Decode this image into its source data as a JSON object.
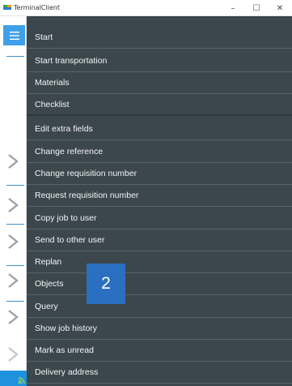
{
  "window": {
    "title": "TerminalClient",
    "minimize_glyph": "–",
    "maximize_glyph": "☐",
    "close_glyph": "✕"
  },
  "menu": {
    "items": [
      {
        "label": "Start"
      },
      {
        "label": "Start transportation"
      },
      {
        "label": "Materials"
      },
      {
        "label": "Checklist"
      },
      {
        "label": "Edit extra fields"
      },
      {
        "label": "Change reference"
      },
      {
        "label": "Change requisition number"
      },
      {
        "label": "Request requisition number"
      },
      {
        "label": "Copy job to user"
      },
      {
        "label": "Send to other user"
      },
      {
        "label": "Replan"
      },
      {
        "label": "Objects"
      },
      {
        "label": "Query"
      },
      {
        "label": "Show job history"
      },
      {
        "label": "Mark as unread"
      },
      {
        "label": "Delivery address"
      }
    ]
  },
  "overlay": {
    "badge_number": "2"
  },
  "colors": {
    "menu_background": "#3c474d",
    "accent": "#3fa0e8",
    "badge": "#2b6fc0"
  },
  "icons": [
    "app-icon",
    "hamburger-menu-icon",
    "chevron-right-icon",
    "wifi-signal-icon"
  ]
}
